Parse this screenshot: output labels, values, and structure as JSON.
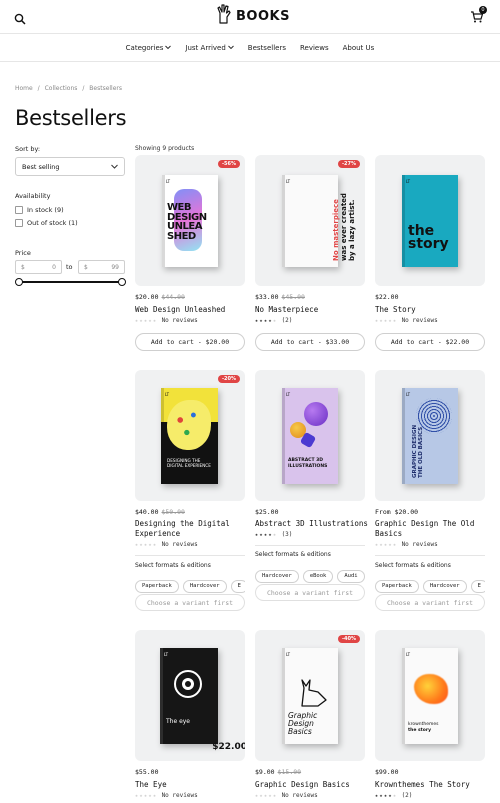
{
  "header": {
    "logo_text": "BOOKS",
    "cart_count": "0"
  },
  "nav": {
    "items": [
      {
        "label": "Categories",
        "has_dropdown": true
      },
      {
        "label": "Just Arrived",
        "has_dropdown": true
      },
      {
        "label": "Bestsellers",
        "has_dropdown": false
      },
      {
        "label": "Reviews",
        "has_dropdown": false
      },
      {
        "label": "About Us",
        "has_dropdown": false
      }
    ]
  },
  "breadcrumb": {
    "home": "Home",
    "sep": "/",
    "collections": "Collections",
    "current": "Bestsellers"
  },
  "page_title": "Bestsellers",
  "sort": {
    "label": "Sort by:",
    "value": "Best selling"
  },
  "filters": {
    "availability_label": "Availability",
    "in_stock": "In stock (9)",
    "out_of_stock": "Out of stock (1)",
    "price_label": "Price",
    "currency": "$",
    "min_placeholder": "0",
    "to": "to",
    "max_placeholder": "99"
  },
  "results_count": "Showing 9 products",
  "products": [
    {
      "title": "Web Design Unleashed",
      "price": "$20.00",
      "compare": "$44.00",
      "badge": "-56%",
      "rating_count": 0,
      "reviews": "No reviews",
      "action": "Add to cart - $20.00",
      "cover_lines": [
        "WEB",
        "DESIGN",
        "UNLEA",
        "SHED"
      ]
    },
    {
      "title": "No Masterpiece",
      "price": "$33.00",
      "compare": "$45.00",
      "badge": "-27%",
      "rating_count": 4,
      "reviews": "(2)",
      "action": "Add to cart - $33.00",
      "cover_lines": [
        "No masterpiece",
        "was ever created",
        "by a lazy artist."
      ]
    },
    {
      "title": "The Story",
      "price": "$22.00",
      "compare": "",
      "badge": "",
      "rating_count": 0,
      "reviews": "No reviews",
      "action": "Add to cart - $22.00",
      "cover_lines": [
        "the",
        "story"
      ]
    },
    {
      "title": "Designing the Digital Experience",
      "title_line1": "Designing the Digital",
      "title_line2": "Experience",
      "price": "$40.00",
      "compare": "$50.00",
      "badge": "-20%",
      "rating_count": 0,
      "reviews": "No reviews",
      "formats_label": "Select formats & editions",
      "formats": [
        "Paperback",
        "Hardcover",
        "E"
      ],
      "action": "Choose a variant first",
      "cover_lines": [
        "DESIGNING THE",
        "DIGITAL EXPERIENCE"
      ]
    },
    {
      "title": "Abstract 3D Illustrations",
      "price": "$25.00",
      "compare": "",
      "badge": "",
      "rating_count": 4,
      "reviews": "(3)",
      "formats_label": "Select formats & editions",
      "formats": [
        "Hardcover",
        "eBook",
        "Audi"
      ],
      "action": "Choose a variant first",
      "cover_lines": [
        "ABSTRACT 3D",
        "ILLUSTRATIONS"
      ]
    },
    {
      "title": "Graphic Design The Old Basics",
      "title_line1": "Graphic Design The Old",
      "title_line2": "Basics",
      "price": "From $20.00",
      "compare": "",
      "badge": "",
      "rating_count": 0,
      "reviews": "No reviews",
      "formats_label": "Select formats & editions",
      "formats": [
        "Paperback",
        "Hardcover",
        "E"
      ],
      "action": "Choose a variant first",
      "cover_lines": [
        "GRAPHIC DESIGN",
        "THE OLD BASICS"
      ]
    },
    {
      "title": "The Eye",
      "price": "$55.00",
      "compare": "",
      "badge": "",
      "rating_count": 0,
      "reviews": "No reviews",
      "cover_lines": [
        "The eye"
      ],
      "cover_price": "$22.00"
    },
    {
      "title": "Graphic Design Basics",
      "price": "$9.00",
      "compare": "$15.00",
      "badge": "-40%",
      "rating_count": 0,
      "reviews": "No reviews",
      "cover_lines": [
        "Graphic",
        "Design Basics"
      ]
    },
    {
      "title": "Krownthemes The Story",
      "price": "$99.00",
      "compare": "",
      "badge": "",
      "rating_count": 4,
      "reviews": "(2)",
      "cover_lines": [
        "krownthemes",
        "the story"
      ]
    }
  ],
  "colors": {
    "badge": "#e04545",
    "teal_cover": "#19a9c0",
    "yellow_cover": "#f2e23a",
    "purple_cover": "#d9c3ec",
    "blue_cover": "#b7c8e6"
  }
}
